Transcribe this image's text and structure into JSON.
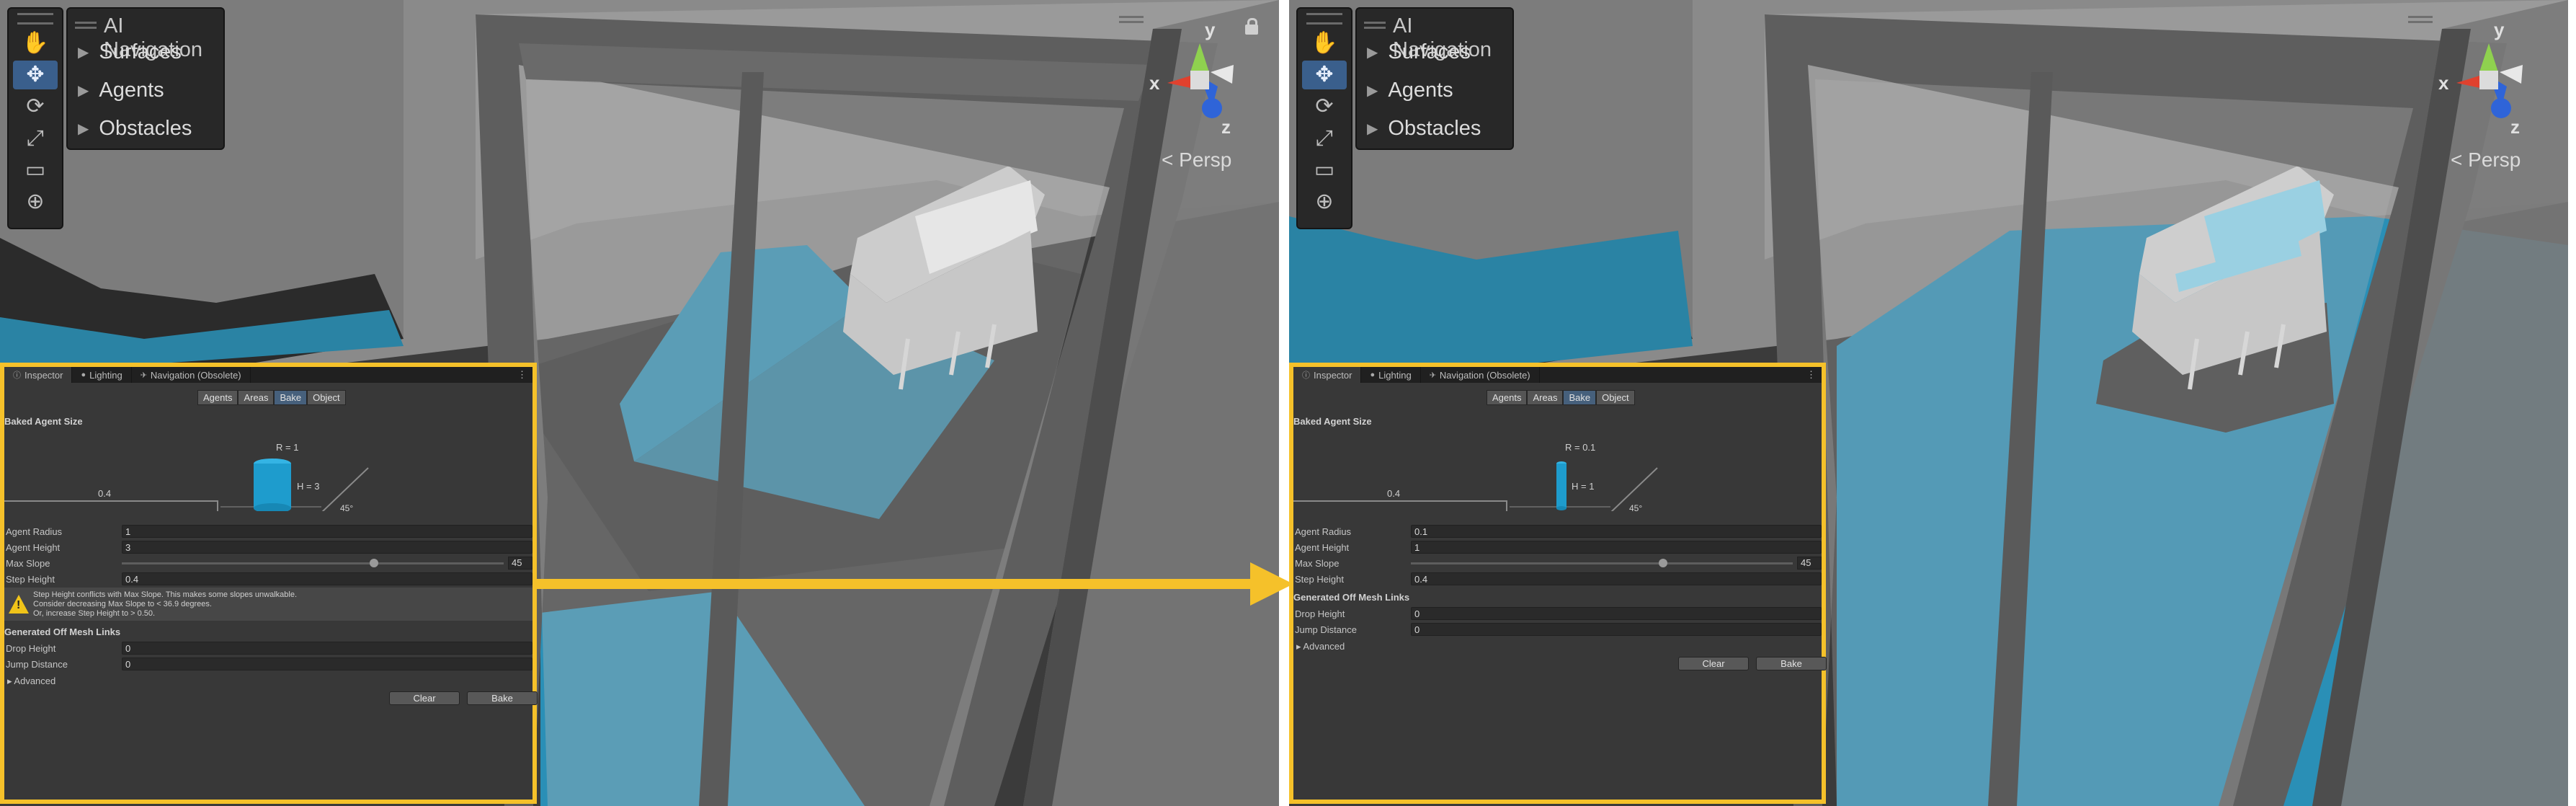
{
  "colors": {
    "highlight": "#f5c12a",
    "navmesh": "#2aa5d2",
    "active_tab": "#46607c"
  },
  "scene": {
    "tools": [
      "hand-icon",
      "move-icon",
      "rotate-icon",
      "scale-icon",
      "rect-icon",
      "transform-icon"
    ],
    "active_tool": "move-icon",
    "overlay": {
      "title": "AI Navigation",
      "items": [
        "Surfaces",
        "Agents",
        "Obstacles"
      ]
    },
    "gizmo": {
      "y": "y",
      "x": "x",
      "z": "z"
    },
    "persp_label": "Persp"
  },
  "inspector": {
    "tabs": [
      "Inspector",
      "Lighting",
      "Navigation (Obsolete)"
    ],
    "modes": [
      "Agents",
      "Areas",
      "Bake",
      "Object"
    ],
    "active_mode": "Bake",
    "baked_agent_size_label": "Baked Agent Size",
    "agent_radius_label": "Agent Radius",
    "agent_height_label": "Agent Height",
    "max_slope_label": "Max Slope",
    "step_height_label": "Step Height",
    "offmesh_heading": "Generated Off Mesh Links",
    "drop_height_label": "Drop Height",
    "jump_distance_label": "Jump Distance",
    "advanced_label": "Advanced",
    "clear_label": "Clear",
    "bake_label": "Bake",
    "slope_angle_label": "45°"
  },
  "before": {
    "radius_label": "R = 1",
    "height_label": "H = 3",
    "step_label": "0.4",
    "agent_radius": "1",
    "agent_height": "3",
    "max_slope": "45",
    "max_slope_fraction": 0.5,
    "step_height": "0.4",
    "drop_height": "0",
    "jump_distance": "0",
    "warning_lines": [
      "Step Height conflicts with Max Slope. This makes some slopes unwalkable.",
      "Consider decreasing Max Slope to < 36.9 degrees.",
      "Or, increase Step Height to > 0.50."
    ]
  },
  "after": {
    "radius_label": "R = 0.1",
    "height_label": "H = 1",
    "step_label": "0.4",
    "agent_radius": "0.1",
    "agent_height": "1",
    "max_slope": "45",
    "max_slope_fraction": 0.5,
    "step_height": "0.4",
    "drop_height": "0",
    "jump_distance": "0"
  }
}
